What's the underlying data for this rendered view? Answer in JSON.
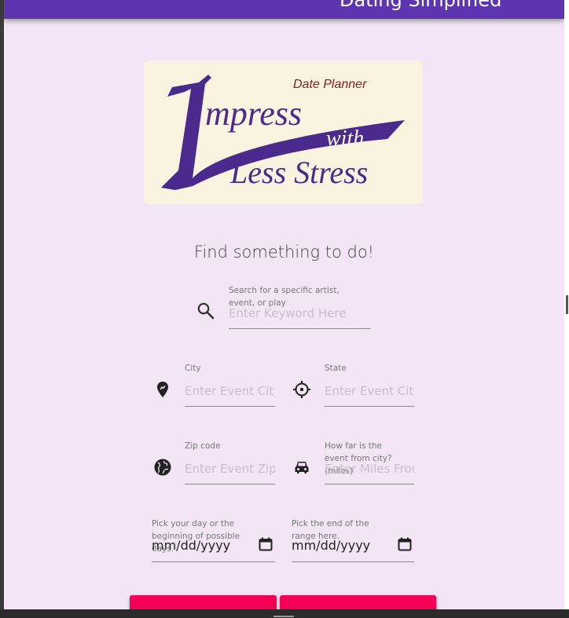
{
  "app_bar": {
    "title": "Dating Simplified",
    "color": "#5e35b1"
  },
  "logo": {
    "tagline": "Date Planner",
    "line1": "mpress",
    "line2": "with",
    "line3": "Less Stress"
  },
  "heading": "Find something to do!",
  "search": {
    "label": "Search for a specific artist, event, or play",
    "placeholder": "Enter Keyword Here",
    "icon": "search-icon"
  },
  "city": {
    "label": "City",
    "placeholder": "Enter Event City",
    "icon": "pin-icon"
  },
  "state": {
    "label": "State",
    "placeholder": "Enter Event City",
    "icon": "crosshair-icon"
  },
  "zip": {
    "label": "Zip code",
    "placeholder": "Enter Event Zipcode",
    "icon": "globe-icon"
  },
  "miles": {
    "label": "How far is the event from city? (miles)",
    "placeholder": "Enter Miles From City",
    "icon": "car-icon"
  },
  "start_date": {
    "label": "Pick your day or the beginning of possible days.",
    "value": "mm/dd/yyyy",
    "icon": "calendar-icon"
  },
  "end_date": {
    "label": "Pick the end of the range here.",
    "value": "mm/dd/yyyy",
    "icon": "calendar-icon"
  },
  "buttons": {
    "color": "#f50057"
  }
}
